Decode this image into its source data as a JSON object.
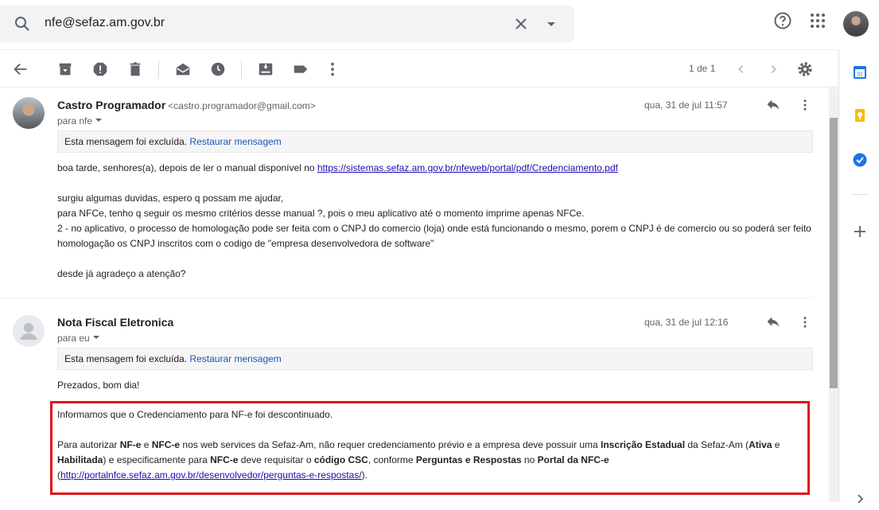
{
  "search": {
    "query": "nfe@sefaz.am.gov.br"
  },
  "pager": {
    "label": "1 de 1"
  },
  "messages": [
    {
      "sender": "Castro Programador",
      "email": "<castro.programador@gmail.com>",
      "to": "para nfe",
      "date": "qua, 31 de jul 11:57",
      "deleted_text": "Esta mensagem foi excluída.",
      "restore_label": "Restaurar mensagem",
      "body": {
        "line1_pre": "boa tarde, senhores(a), depois de ler o manual disponível no ",
        "line1_link": "https://sistemas.sefaz.am.gov.br/nfeweb/portal/pdf/Credenciamento.pdf",
        "line2": "surgiu algumas duvidas, espero q possam me ajudar,",
        "line3": "para NFCe, tenho q seguir os mesmo critérios desse manual ?, pois o meu aplicativo até o momento imprime apenas NFCe.",
        "line4": " 2 - no aplicativo, o processo de homologação pode ser feita com o CNPJ do comercio (loja) onde está funcionando o mesmo, porem o CNPJ é de comercio ou so poderá ser feito homologação os CNPJ inscritos com o codigo de \"empresa desenvolvedora de software\"",
        "line5": "desde já agradeço a atenção?"
      }
    },
    {
      "sender": "Nota Fiscal Eletronica",
      "to": "para eu",
      "date": "qua, 31 de jul 12:16",
      "deleted_text": "Esta mensagem foi excluída.",
      "restore_label": "Restaurar mensagem",
      "greeting": "Prezados, bom dia!",
      "quoted": {
        "p1": "Informamos que o Credenciamento para NF-e foi descontinuado.",
        "s1": "Para autorizar ",
        "b1": "NF-e",
        "s2": " e ",
        "b2": "NFC-e",
        "s3": " nos web services da Sefaz-Am, não requer credenciamento prévio e a empresa deve possuir uma ",
        "b3": "Inscrição Estadual",
        "s4": " da Sefaz-Am (",
        "b4": "Ativa",
        "s5": " e ",
        "b5": "Habilitada",
        "s6": ") e especificamente para ",
        "b6": "NFC-e",
        "s7": " deve requisitar o ",
        "b7": "código CSC",
        "s8": ", conforme ",
        "b8": "Perguntas e Respostas",
        "s9": " no ",
        "b9": "Portal da NFC-e",
        "s10": "(",
        "link": "http://portalnfce.sefaz.am.gov.br/desenvolvedor/perguntas-e-respostas/",
        "s11": ")."
      }
    }
  ],
  "colors": {
    "highlight_border": "#e1131a",
    "link": "#1a0dab"
  },
  "icons": [
    "search-icon",
    "clear-icon",
    "dropdown-icon",
    "help-icon",
    "apps-icon",
    "back-icon",
    "archive-icon",
    "report-spam-icon",
    "delete-icon",
    "mark-unread-icon",
    "snooze-icon",
    "move-to-icon",
    "label-icon",
    "more-icon",
    "settings-icon",
    "calendar-icon",
    "keep-icon",
    "tasks-icon",
    "add-icon",
    "reply-icon"
  ]
}
